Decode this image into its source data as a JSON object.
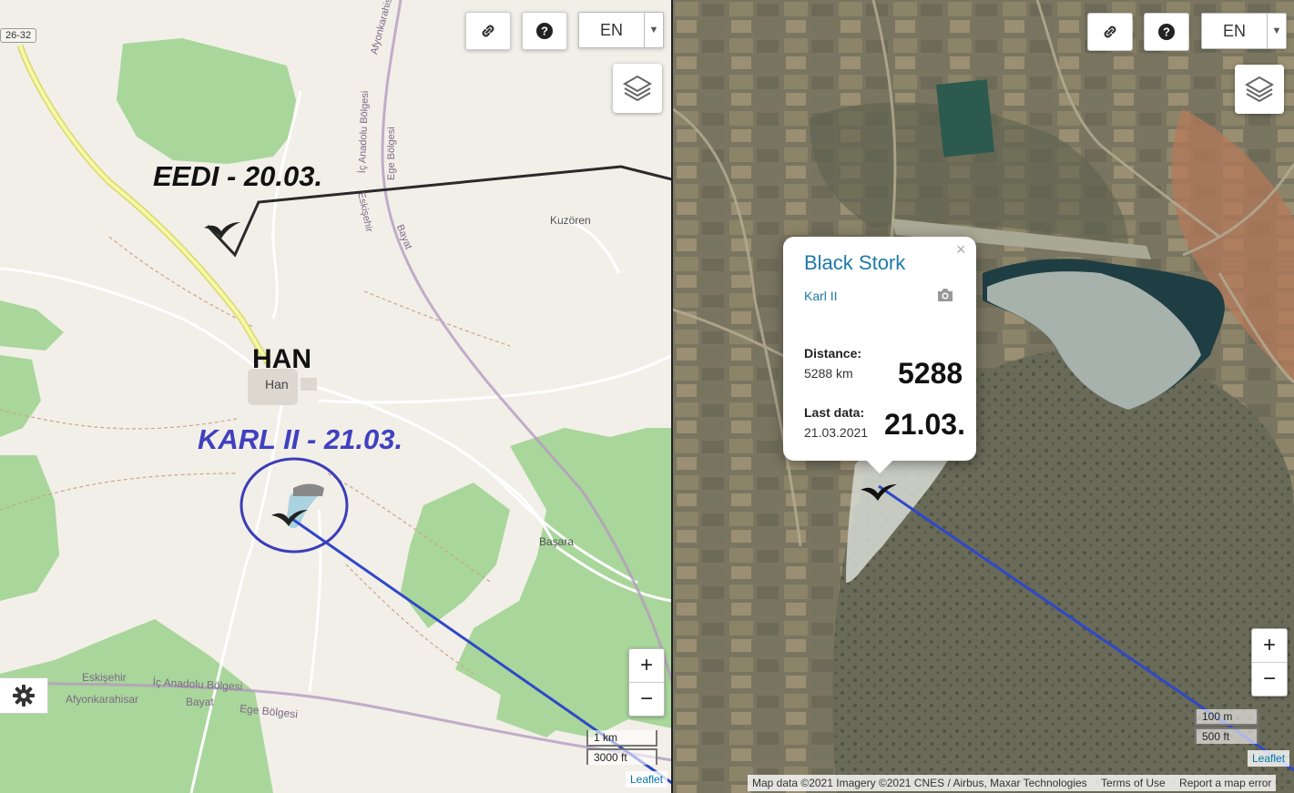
{
  "left_map": {
    "road_badge": "26-32",
    "place_labels": {
      "han_big": "HAN",
      "han_small": "Han",
      "kuzoren": "Kuzören",
      "basara": "Başara",
      "road_afyonkarahisar_top": "Afyonkarahisar",
      "road_ic_anadolu_top": "İç Anadolu Bölgesi",
      "road_ege_top": "Ege Bölgesi",
      "road_eskisehir_top": "Eskişehir",
      "road_bayat_top": "Bayat",
      "region_eskisehir": "Eskişehir",
      "region_afyonkarahisar": "Afyonkarahisar",
      "region_ic_anadolu": "İç Anadolu Bölgesi",
      "region_bayat": "Bayat",
      "region_ege": "Ege Bölgesi"
    },
    "annotations": {
      "eedi": "EEDI - 20.03.",
      "karl": "KARL II - 21.03."
    },
    "language": "EN",
    "zoom_in": "+",
    "zoom_out": "−",
    "scale_metric": "1 km",
    "scale_imperial": "3000 ft",
    "attribution": "Leaflet"
  },
  "right_map": {
    "language": "EN",
    "zoom_in": "+",
    "zoom_out": "−",
    "scale_metric": "100 m",
    "scale_imperial": "500 ft",
    "leaflet": "Leaflet",
    "attribution_data": "Map data ©2021 Imagery ©2021 CNES / Airbus, Maxar Technologies",
    "attribution_terms": "Terms of Use",
    "attribution_report": "Report a map error",
    "popup": {
      "species": "Black Stork",
      "bird_name": "Karl II",
      "close": "×",
      "distance_label": "Distance:",
      "distance_value": "5288 km",
      "distance_big": "5288",
      "lastdata_label": "Last data:",
      "lastdata_value": "21.03.2021",
      "lastdata_big": "21.03."
    }
  },
  "colors": {
    "track_blue": "#2f48c8",
    "track_black": "#2a2a2a",
    "annotation_blue": "#4040c0",
    "forest": "#a9d69a",
    "popup_link": "#1e7aa8"
  }
}
